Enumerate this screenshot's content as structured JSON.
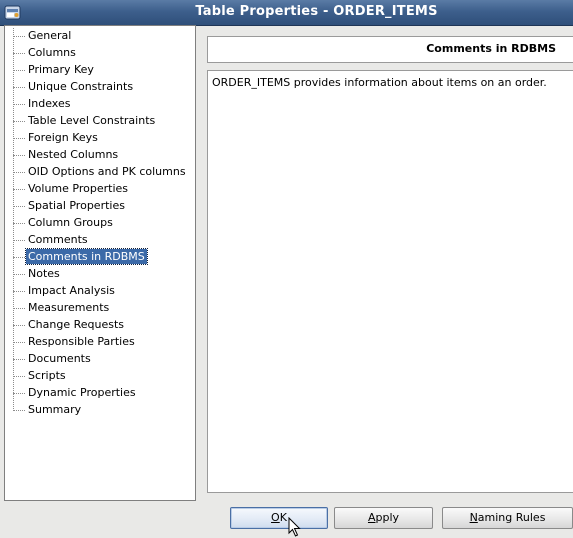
{
  "window": {
    "title": "Table Properties - ORDER_ITEMS"
  },
  "nav": {
    "items": [
      {
        "label": "General"
      },
      {
        "label": "Columns"
      },
      {
        "label": "Primary Key"
      },
      {
        "label": "Unique Constraints"
      },
      {
        "label": "Indexes"
      },
      {
        "label": "Table Level Constraints"
      },
      {
        "label": "Foreign Keys"
      },
      {
        "label": "Nested Columns"
      },
      {
        "label": "OID Options and PK columns"
      },
      {
        "label": "Volume Properties"
      },
      {
        "label": "Spatial Properties"
      },
      {
        "label": "Column Groups"
      },
      {
        "label": "Comments"
      },
      {
        "label": "Comments in RDBMS",
        "selected": true
      },
      {
        "label": "Notes"
      },
      {
        "label": "Impact Analysis"
      },
      {
        "label": "Measurements"
      },
      {
        "label": "Change Requests"
      },
      {
        "label": "Responsible Parties"
      },
      {
        "label": "Documents"
      },
      {
        "label": "Scripts"
      },
      {
        "label": "Dynamic Properties"
      },
      {
        "label": "Summary"
      }
    ]
  },
  "panel": {
    "header": "Comments in RDBMS",
    "comment_text": "ORDER_ITEMS provides information about items on an order."
  },
  "buttons": {
    "ok": {
      "label": "OK",
      "mnemonic": "O"
    },
    "apply": {
      "label": "Apply",
      "mnemonic": "A"
    },
    "naming_rules": {
      "label": "Naming Rules",
      "mnemonic": "N"
    }
  },
  "colors": {
    "titlebar": "#3d5f8c",
    "selection": "#3c6aa8"
  },
  "icons": {
    "title": "app-window-icon",
    "cursor": "mouse-pointer-icon"
  }
}
